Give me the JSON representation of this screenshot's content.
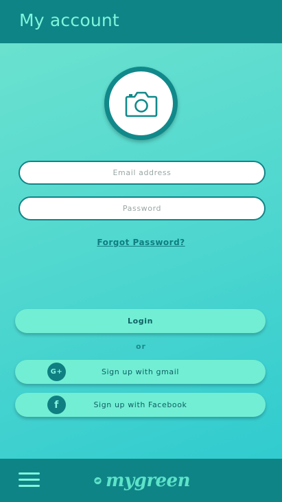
{
  "header": {
    "title": "My account"
  },
  "avatar": {
    "icon": "camera-icon"
  },
  "form": {
    "email_placeholder": "Email address",
    "password_placeholder": "Password",
    "forgot_label": "Forgot Password?"
  },
  "actions": {
    "login_label": "Login",
    "or_label": "or",
    "gmail_label": "Sign up with gmail",
    "gmail_icon_text": "G+",
    "facebook_label": "Sign up with Facebook",
    "facebook_icon_text": "f"
  },
  "footer": {
    "menu_icon": "hamburger-menu-icon",
    "logo_text": "mygreen"
  },
  "colors": {
    "primary_dark": "#0f8486",
    "accent_mint": "#7ff5dc",
    "button_fill": "#72eed4"
  }
}
